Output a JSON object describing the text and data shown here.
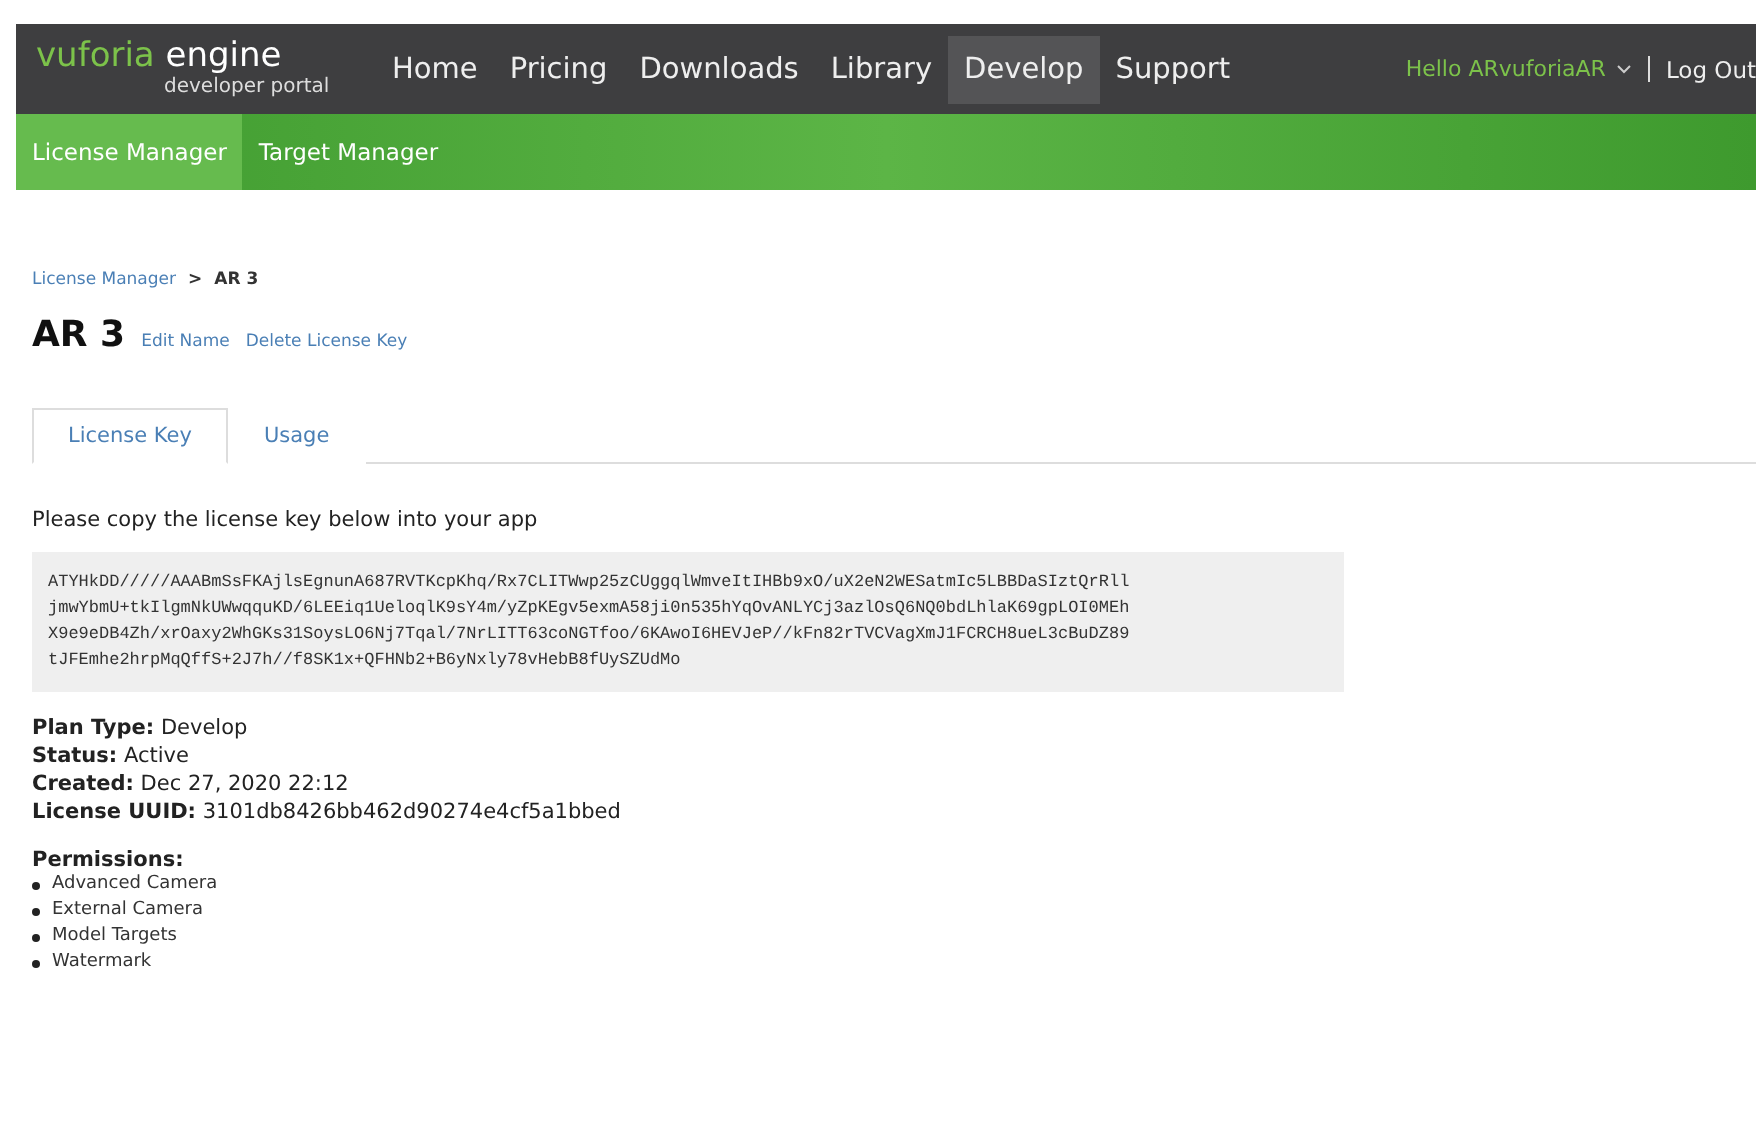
{
  "header": {
    "logo": {
      "brand": "vuforia",
      "product": "engine",
      "subtitle": "developer portal"
    },
    "nav": [
      {
        "label": "Home",
        "selected": false
      },
      {
        "label": "Pricing",
        "selected": false
      },
      {
        "label": "Downloads",
        "selected": false
      },
      {
        "label": "Library",
        "selected": false
      },
      {
        "label": "Develop",
        "selected": true
      },
      {
        "label": "Support",
        "selected": false
      }
    ],
    "user_menu": "Hello ARvuforiaAR",
    "logout": "Log Out"
  },
  "subnav": [
    {
      "label": "License Manager",
      "selected": true
    },
    {
      "label": "Target Manager",
      "selected": false
    }
  ],
  "breadcrumb": {
    "parent": "License Manager",
    "separator": ">",
    "current": "AR 3"
  },
  "title": "AR 3",
  "title_actions": [
    "Edit Name",
    "Delete License Key"
  ],
  "tabs": [
    {
      "label": "License Key",
      "selected": true
    },
    {
      "label": "Usage",
      "selected": false
    }
  ],
  "instruction": "Please copy the license key below into your app",
  "license_key_lines": [
    "ATYHkDD/////AAABmSsFKAjlsEgnunA687RVTKcpKhq/Rx7CLITWwp25zCUggqlWmveItIHBb9xO/uX2eN2WESatmIc5LBBDaSIztQrRll",
    "jmwYbmU+tkIlgmNkUWwqquKD/6LEEiq1UeloqlK9sY4m/yZpKEgv5exmA58ji0n535hYqOvANLYCj3azlOsQ6NQ0bdLhlaK69gpLOI0MEh",
    "X9e9eDB4Zh/xrOaxy2WhGKs31SoysLO6Nj7Tqal/7NrLITT63coNGTfoo/6KAwoI6HEVJeP//kFn82rTVCVagXmJ1FCRCH8ueL3cBuDZ89",
    "tJFEmhe2hrpMqQffS+2J7h//f8SK1x+QFHNb2+B6yNxly78vHebB8fUySZUdMo"
  ],
  "details": [
    {
      "label": "Plan Type:",
      "value": "Develop"
    },
    {
      "label": "Status:",
      "value": "Active"
    },
    {
      "label": "Created:",
      "value": "Dec 27, 2020 22:12"
    },
    {
      "label": "License UUID:",
      "value": "3101db8426bb462d90274e4cf5a1bbed"
    }
  ],
  "permissions": {
    "title": "Permissions:",
    "items": [
      "Advanced Camera",
      "External Camera",
      "Model Targets",
      "Watermark"
    ]
  }
}
